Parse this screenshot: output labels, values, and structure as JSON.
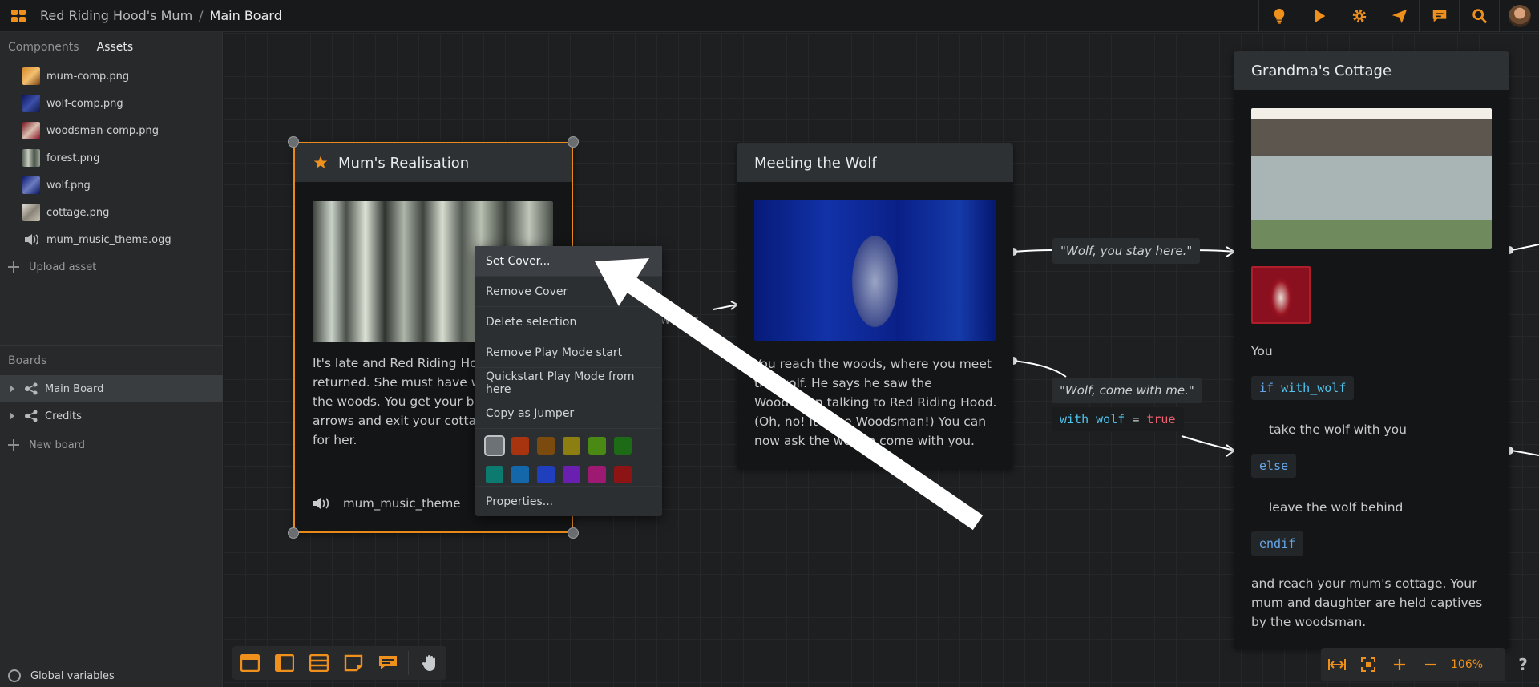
{
  "topbar": {
    "project": "Red Riding Hood's Mum",
    "separator": "/",
    "board": "Main Board"
  },
  "toolbar_icons": [
    "lightbulb-icon",
    "play-icon",
    "gear-icon",
    "paper-plane-icon",
    "chat-icon",
    "search-icon"
  ],
  "colors": {
    "accent": "#f0901c",
    "selection": "#e8891a",
    "keyword": "#66a6e8",
    "variable": "#4fc4ee",
    "value": "#f06070"
  },
  "sidebar": {
    "tabs": [
      {
        "label": "Components"
      },
      {
        "label": "Assets"
      }
    ],
    "assets": [
      {
        "label": "mum-comp.png"
      },
      {
        "label": "wolf-comp.png"
      },
      {
        "label": "woodsman-comp.png"
      },
      {
        "label": "forest.png"
      },
      {
        "label": "wolf.png"
      },
      {
        "label": "cottage.png"
      },
      {
        "label": "mum_music_theme.ogg"
      }
    ],
    "upload_label": "Upload asset",
    "boards_heading": "Boards",
    "boards": [
      {
        "label": "Main Board"
      },
      {
        "label": "Credits"
      }
    ],
    "new_board_label": "New board",
    "global_variables_label": "Global variables"
  },
  "nodes": {
    "mum": {
      "title": "Mum's Realisation",
      "lines": [
        "It's late and Red Riding Hoo",
        "returned. She must have w",
        "the woods. You get your bo",
        "arrows and exit your cottag",
        "for her."
      ],
      "audio": "mum_music_theme"
    },
    "wolf": {
      "title": "Meeting the Wolf",
      "lines": [
        "You reach the woods, where you meet",
        "the wolf. He says he saw the",
        "Woodsman talking to Red Riding Hood.",
        "(Oh, no! It's the Woodsman!) You can",
        "now ask the wolf to come with you."
      ]
    },
    "cottage": {
      "title": "Grandma's Cottage",
      "you": "You",
      "if_kw": "if",
      "if_var": "with_wolf",
      "take": "take the wolf with you",
      "else_kw": "else",
      "leave": "leave the wolf behind",
      "endif_kw": "endif",
      "end_lines": [
        "and reach your mum's cottage. Your",
        "mum and daughter are held captives",
        "by the woodsman."
      ]
    }
  },
  "connections": {
    "stay": "\"Wolf, you stay here.\"",
    "come": "\"Wolf, come with me.\"",
    "cond_var": "with_wolf",
    "cond_op": "=",
    "cond_val": "true",
    "woods_fragment": "woods."
  },
  "context_menu": {
    "items": [
      "Set Cover...",
      "Remove Cover",
      "Delete selection",
      "Remove Play Mode start",
      "Quickstart Play Mode from here",
      "Copy as Jumper"
    ],
    "swatches": [
      "#6c7276",
      "#a8340f",
      "#7a4a0e",
      "#8c7e10",
      "#4a8a14",
      "#1d6b17",
      "#0c7a6e",
      "#1467a8",
      "#1f3fbf",
      "#6b1fb0",
      "#9e1a72",
      "#8c1414"
    ],
    "properties": "Properties..."
  },
  "zoom": {
    "level": "106%"
  },
  "help": "?"
}
